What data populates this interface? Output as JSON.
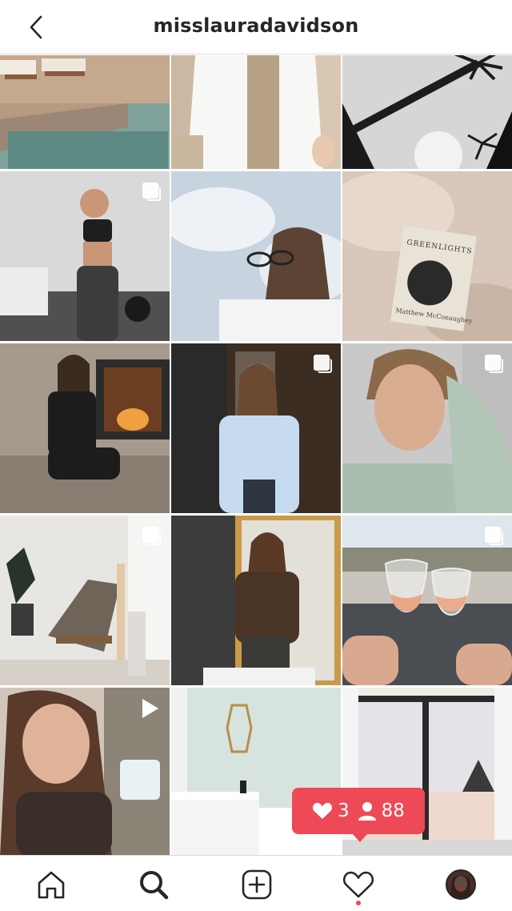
{
  "header": {
    "title": "misslauradavidson",
    "back_icon": "chevron-left-icon"
  },
  "posts": [
    {
      "name": "post-spa-pool",
      "multi": false,
      "video": false
    },
    {
      "name": "post-white-shirt",
      "multi": false,
      "video": false
    },
    {
      "name": "post-palm-trees",
      "multi": false,
      "video": false
    },
    {
      "name": "post-gym-selfie",
      "multi": true,
      "video": false
    },
    {
      "name": "post-sunglasses-sky",
      "multi": false,
      "video": false
    },
    {
      "name": "post-greenlights-book",
      "multi": false,
      "video": false
    },
    {
      "name": "post-fireplace",
      "multi": false,
      "video": false
    },
    {
      "name": "post-blue-shirt",
      "multi": true,
      "video": false
    },
    {
      "name": "post-green-sweatshirt",
      "multi": true,
      "video": false
    },
    {
      "name": "post-living-room-chair",
      "multi": true,
      "video": false
    },
    {
      "name": "post-mirror-selfie",
      "multi": false,
      "video": false
    },
    {
      "name": "post-wine-toast",
      "multi": true,
      "video": false
    },
    {
      "name": "post-outdoor-coffee",
      "multi": false,
      "video": true
    },
    {
      "name": "post-bathroom",
      "multi": false,
      "video": false
    },
    {
      "name": "post-window-view",
      "multi": false,
      "video": false
    }
  ],
  "book": {
    "title": "GREENLIGHTS",
    "author": "Matthew McConaughey"
  },
  "activity": {
    "likes": "3",
    "followers": "88",
    "color": "#ed4956"
  },
  "tabs": [
    "home-icon",
    "search-icon",
    "new-post-icon",
    "heart-icon",
    "profile-avatar"
  ]
}
